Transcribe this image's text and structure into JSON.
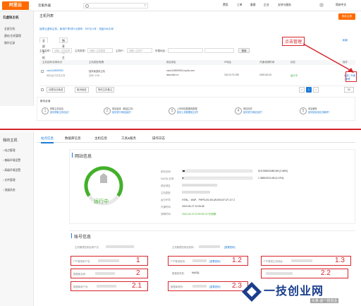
{
  "topbar": {
    "logo": "阿里云",
    "title": "云服务器",
    "search_placeholder": "搜索",
    "nav": [
      "费用",
      "工单",
      "备案",
      "企业",
      "支持与服务"
    ],
    "user": "简体中文"
  },
  "side1": {
    "header": "云虚拟主机",
    "items": [
      "全部主机",
      "建站/主机管理",
      "操作记录"
    ]
  },
  "list_page": {
    "title": "主机列表",
    "buy_button": "购买主机",
    "notice": "独享云虚拟主机，新用户享3折1元首年 · 597元/1年 · 流量298元/年",
    "tabs": [
      "全部主机",
      "独享版主机"
    ],
    "refresh_link": "刷新",
    "filter": {
      "domain_label": "主机名称：",
      "domain_placeholder": "请输入主机名称",
      "type_label": "主机类型：",
      "type_placeholder": "请输入主机类型",
      "ip_label": "主机IP：",
      "ip_placeholder": "请输入主机IP",
      "region_label": "所属地区：",
      "search_button": "搜索"
    },
    "table_headers": [
      "主机名称/实例标识",
      "主机类型/配置",
      "绑定域名",
      "IP地址",
      "开通/到期时间",
      "状态",
      "操作"
    ],
    "row": {
      "name": "osu0445593953",
      "sub": "网站运行状态正常",
      "type": "独享版虚拟主机",
      "spec": "空间: 1GB ...",
      "domain": "osu0445593953.my3w.com",
      "domain2": "itasonkid.cn",
      "ip": "119.23.70.195",
      "date": "2020-06-03",
      "status": "运行中",
      "ops": "续费 | 升级 | 管理"
    },
    "footer_buttons": [
      "设置自动续费",
      "取消续费",
      "修改主机备注"
    ],
    "pagination": [
      "<",
      "1",
      ">"
    ],
    "page_size": "50"
  },
  "steps": {
    "header": "新手必读",
    "items": [
      {
        "num": "1",
        "text": "获取主机信息\n如何获取主机信息？"
      },
      {
        "num": "2",
        "text": "网站建设（新建主机）\n如何进行网站建设？"
      },
      {
        "num": "3",
        "text": "上传网站数据库数据\n如何上传数据到主机？"
      },
      {
        "num": "4",
        "text": "网站测试\n如何进行网站测试？"
      },
      {
        "num": "5",
        "text": "域名解析\n如何绑定域名并解析？"
      }
    ]
  },
  "annotation_top": "点击管理",
  "side2": {
    "header": "我的主机",
    "items": [
      "站点管理",
      "基础环境设置",
      "高级环境设置",
      "文件管理",
      "流量状态"
    ]
  },
  "tabs2": [
    "站点信息",
    "数据库信息",
    "主机信息",
    "工具&服务",
    "操作日志"
  ],
  "stop_button": "停止站点",
  "site_info": {
    "title": "网站信息",
    "status": "运行中",
    "rows": [
      {
        "label": "网页空间:",
        "value": "519.00M/20480.0M (2.58%)",
        "fill": 0.0258
      },
      {
        "label": "MySQL空间:",
        "value": "1.36M/1024.0M (0.13%)",
        "fill": 0.0013
      },
      {
        "label": "绑定域名:",
        "value": ""
      },
      {
        "label": "主机类型:",
        "value": ""
      },
      {
        "label": "运行环境:",
        "value": "HTML、WAP、PHP5.2/5.3/5.4/5.5/5.6/7.0/7.1/7.2"
      },
      {
        "label": "开通时间:",
        "value": "2019-05-27 22:05:48"
      },
      {
        "label": "到期时间:",
        "value": "2020-06-03 23:59:59   247天到期"
      }
    ]
  },
  "account_info": {
    "title": "账号信息",
    "top_left_label": "主机管理控制台用户名:",
    "top_right_label": "主机管理控制台密码:",
    "reset_label": "[重置密码]",
    "cells": [
      {
        "label": "FTP登录用户名:",
        "num": "1"
      },
      {
        "label": "FTP登录密码:",
        "num": "1.2",
        "link": "[重置密码]"
      },
      {
        "label": "FTP登录主机地址:",
        "num": "1.3"
      },
      {
        "label": "数据库名称:",
        "num": "2"
      },
      {
        "label": "数据库类型:",
        "value": "MySQL",
        "num": "2.2"
      },
      {
        "label": "数据库用户名:",
        "num": "2.1"
      },
      {
        "label": "数据库密码:",
        "num": "2.3",
        "link": "[重置密码]"
      }
    ]
  },
  "watermark": {
    "text": "一技创业网",
    "sub": "头条 @一技创业"
  },
  "colors": {
    "accent": "#ff6a00",
    "link": "#1e7bd8",
    "annotation": "#d6252d"
  }
}
